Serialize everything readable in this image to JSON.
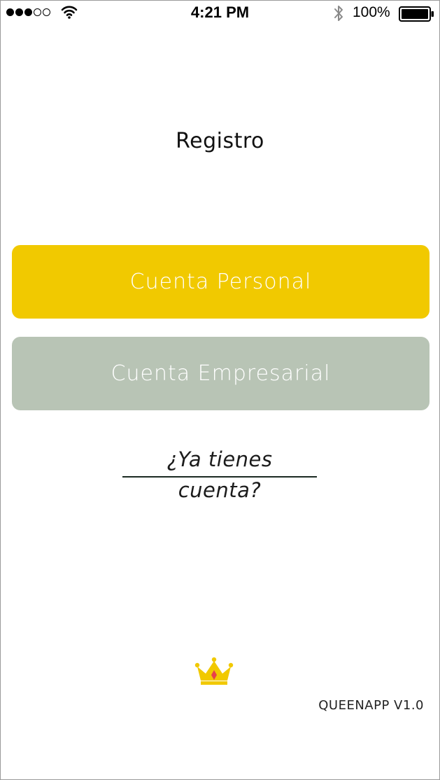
{
  "status_bar": {
    "signal_dots_full": 3,
    "signal_dots_total": 5,
    "time": "4:21 PM",
    "battery_percent": "100%",
    "icons": [
      "wifi-icon",
      "bluetooth-icon",
      "battery-icon"
    ]
  },
  "screen": {
    "title": "Registro",
    "personal_button": "Cuenta Personal",
    "business_button": "Cuenta Empresarial",
    "login_link": "¿Ya tienes cuenta?",
    "version": "QUEENAPP V1.0",
    "logo_icon": "crown-icon"
  },
  "colors": {
    "personal_button_bg": "#f1c900",
    "business_button_bg": "#b8c4b5",
    "crown_gold": "#f1c900",
    "crown_gem": "#e8404a"
  }
}
